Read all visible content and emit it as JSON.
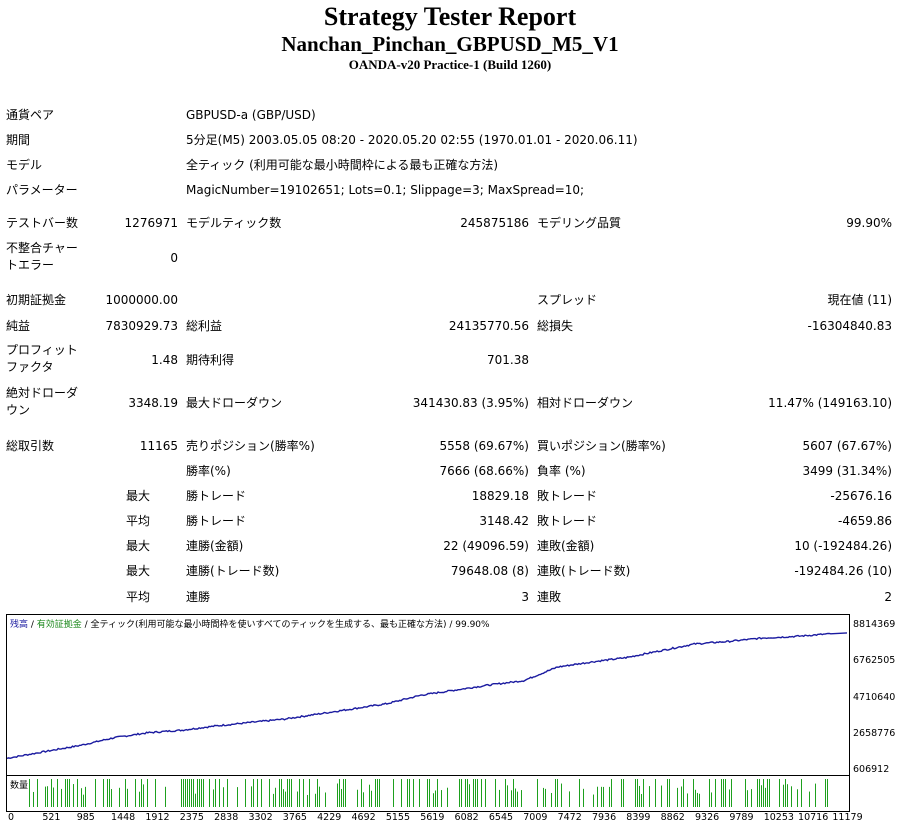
{
  "report": {
    "title": "Strategy Tester Report",
    "subtitle": "Nanchan_Pinchan_GBPUSD_M5_V1",
    "server": "OANDA-v20 Practice-1 (Build 1260)"
  },
  "info": {
    "symbol_label": "通貨ペア",
    "symbol_value": "GBPUSD-a (GBP/USD)",
    "period_label": "期間",
    "period_value": "5分足(M5) 2003.05.05 08:20 - 2020.05.20 02:55 (1970.01.01 - 2020.06.11)",
    "model_label": "モデル",
    "model_value": "全ティック (利用可能な最小時間枠による最も正確な方法)",
    "params_label": "パラメーター",
    "params_value": "MagicNumber=19102651; Lots=0.1; Slippage=3; MaxSpread=10;"
  },
  "stats": {
    "bars_label": "テストバー数",
    "bars_value": "1276971",
    "ticks_label": "モデルティック数",
    "ticks_value": "245875186",
    "quality_label": "モデリング品質",
    "quality_value": "99.90%",
    "mismatch_label": "不整合チャートエラー",
    "mismatch_value": "0",
    "deposit_label": "初期証拠金",
    "deposit_value": "1000000.00",
    "spread_label": "スプレッド",
    "spread_value": "現在値 (11)",
    "net_label": "純益",
    "net_value": "7830929.73",
    "gross_profit_label": "総利益",
    "gross_profit_value": "24135770.56",
    "gross_loss_label": "総損失",
    "gross_loss_value": "-16304840.83",
    "pf_label": "プロフィットファクタ",
    "pf_value": "1.48",
    "expected_label": "期待利得",
    "expected_value": "701.38",
    "abs_dd_label": "絶対ドローダウン",
    "abs_dd_value": "3348.19",
    "max_dd_label": "最大ドローダウン",
    "max_dd_value": "341430.83 (3.95%)",
    "rel_dd_label": "相対ドローダウン",
    "rel_dd_value": "11.47% (149163.10)",
    "trades_label": "総取引数",
    "trades_value": "11165",
    "short_label": "売りポジション(勝率%)",
    "short_value": "5558 (69.67%)",
    "long_label": "買いポジション(勝率%)",
    "long_value": "5607 (67.67%)",
    "winrate_label": "勝率(%)",
    "winrate_value": "7666 (68.66%)",
    "lossrate_label": "負率 (%)",
    "lossrate_value": "3499 (31.34%)",
    "max_label": "最大",
    "avg_label": "平均",
    "largest_win_label": "勝トレード",
    "largest_win_value": "18829.18",
    "largest_loss_label": "敗トレード",
    "largest_loss_value": "-25676.16",
    "avg_win_label": "勝トレード",
    "avg_win_value": "3148.42",
    "avg_loss_label": "敗トレード",
    "avg_loss_value": "-4659.86",
    "max_cons_wins_label": "連勝(金額)",
    "max_cons_wins_value": "22 (49096.59)",
    "max_cons_losses_label": "連敗(金額)",
    "max_cons_losses_value": "10 (-192484.26)",
    "max_cons_profit_label": "連勝(トレード数)",
    "max_cons_profit_value": "79648.08 (8)",
    "max_cons_loss_label": "連敗(トレード数)",
    "max_cons_loss_value": "-192484.26 (10)",
    "avg_cons_wins_label": "連勝",
    "avg_cons_wins_value": "3",
    "avg_cons_losses_label": "連敗",
    "avg_cons_losses_value": "2"
  },
  "graph": {
    "legend_balance": "残高",
    "legend_sep1": " / ",
    "legend_equity": "有効証拠金",
    "legend_rest": " / 全ティック(利用可能な最小時間枠を使いすべてのティックを生成する、最も正確な方法) / 99.90%",
    "volume_label": "数量",
    "line_color": "#1a1aa0",
    "volume_color": "#1ea01e",
    "y_ticks": [
      "8814369",
      "6762505",
      "4710640",
      "2658776",
      "606912"
    ],
    "x_ticks": [
      "0",
      "521",
      "985",
      "1448",
      "1912",
      "2375",
      "2838",
      "3302",
      "3765",
      "4229",
      "4692",
      "5155",
      "5619",
      "6082",
      "6545",
      "7009",
      "7472",
      "7936",
      "8399",
      "8862",
      "9326",
      "9789",
      "10253",
      "10716",
      "11179"
    ]
  },
  "chart_data": {
    "type": "line",
    "x": [
      0,
      521,
      985,
      1448,
      1912,
      2375,
      2838,
      3302,
      3765,
      4229,
      4692,
      5155,
      5619,
      6082,
      6545,
      7009,
      7472,
      7936,
      8399,
      8862,
      9326,
      9789,
      10253,
      10716,
      11179
    ],
    "series": [
      {
        "name": "残高",
        "values": [
          1000000,
          1400000,
          1750000,
          2200000,
          2500000,
          2650000,
          2900000,
          3100000,
          3300000,
          3600000,
          3900000,
          4200000,
          4700000,
          5000000,
          5300000,
          5550000,
          6350000,
          6650000,
          6900000,
          7300000,
          7700000,
          7850000,
          8050000,
          8150000,
          8300000
        ]
      }
    ],
    "ylim": [
      606912,
      8814369
    ],
    "xlim": [
      0,
      11400
    ]
  }
}
